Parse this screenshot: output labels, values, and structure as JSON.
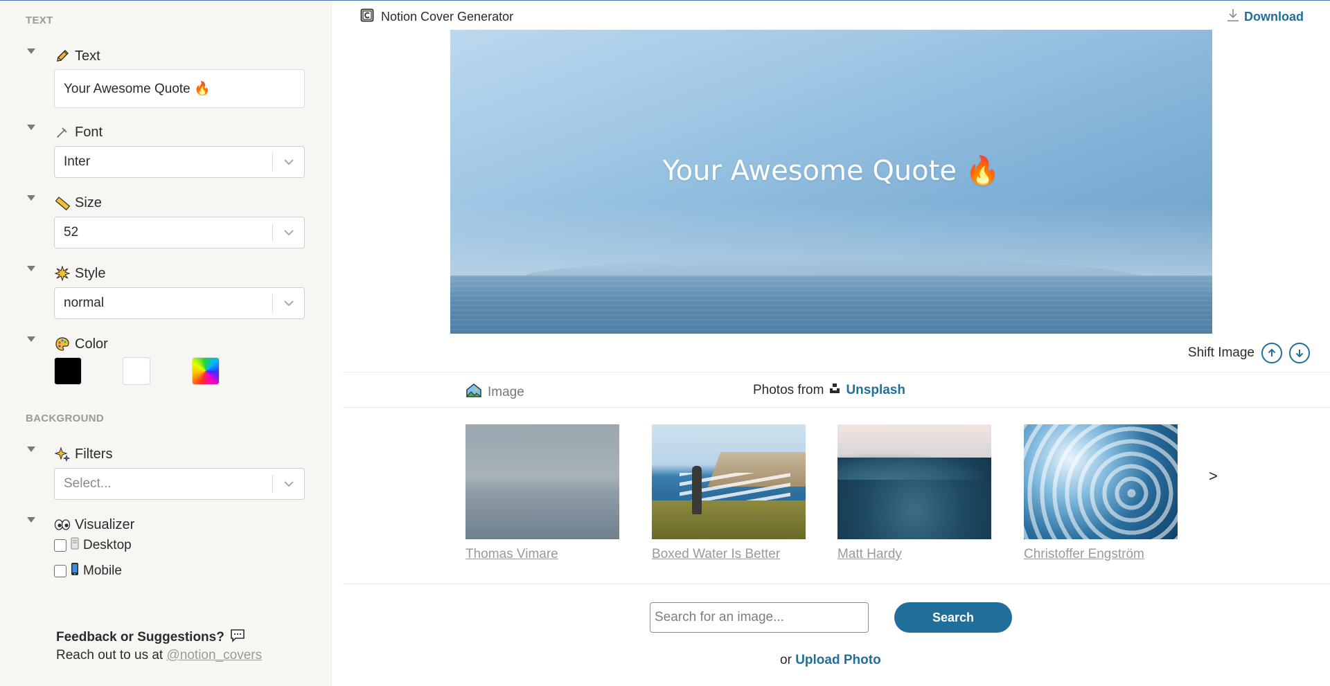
{
  "app": {
    "title": "Notion Cover Generator",
    "download_label": "Download"
  },
  "sidebar": {
    "text_section_label": "TEXT",
    "background_section_label": "BACKGROUND",
    "text_field": {
      "label": "Text",
      "value": "Your Awesome Quote 🔥",
      "icon": "pencil-icon"
    },
    "font_field": {
      "label": "Font",
      "value": "Inter",
      "icon": "pen-nib-icon"
    },
    "size_field": {
      "label": "Size",
      "value": "52",
      "icon": "ruler-icon"
    },
    "style_field": {
      "label": "Style",
      "value": "normal",
      "icon": "sparkle-burst-icon"
    },
    "color_field": {
      "label": "Color",
      "icon": "palette-icon",
      "swatches": [
        "#000000",
        "#ffffff",
        "rainbow"
      ]
    },
    "filters_field": {
      "label": "Filters",
      "placeholder": "Select...",
      "icon": "sparkles-icon"
    },
    "visualizer": {
      "label": "Visualizer",
      "icon": "eyes-icon",
      "options": [
        {
          "label": "Desktop",
          "checked": false,
          "icon": "desktop-icon"
        },
        {
          "label": "Mobile",
          "checked": false,
          "icon": "mobile-phone-icon"
        }
      ]
    },
    "feedback": {
      "title": "Feedback or Suggestions?",
      "reach_text": "Reach out to us at",
      "handle": "@notion_covers"
    }
  },
  "preview": {
    "quote": "Your Awesome Quote 🔥",
    "shift_label": "Shift Image"
  },
  "gallery": {
    "tab_label": "Image",
    "photos_from": "Photos from",
    "source": "Unsplash",
    "photographers": [
      "Thomas Vimare",
      "Boxed Water Is Better",
      "Matt Hardy",
      "Christoffer Engström"
    ],
    "next_label": ">",
    "search_placeholder": "Search for an image...",
    "search_button": "Search",
    "upload_prefix": "or",
    "upload_label": "Upload Photo"
  },
  "colors": {
    "accent": "#1f6f9a",
    "sidebar_bg": "#f7f6f3",
    "muted_text": "#9b9a97"
  }
}
